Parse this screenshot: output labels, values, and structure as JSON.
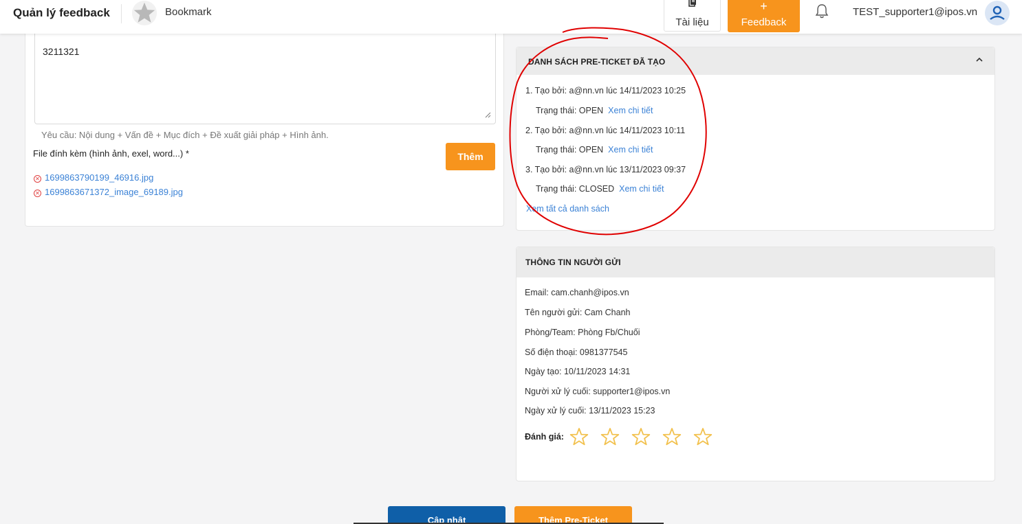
{
  "topbar": {
    "title": "Quản lý feedback",
    "bookmark_label": "Bookmark",
    "docs_label": "Tài liệu",
    "feedback_plus": "+",
    "feedback_label": "Feedback",
    "user_email": "TEST_supporter1@ipos.vn",
    "icons": [
      "star-icon",
      "book-icon",
      "bell-icon",
      "user-icon"
    ]
  },
  "form": {
    "content_value": "3211321",
    "hint": "Yêu cầu: Nội dung + Vấn đề + Mục đích + Đề xuất giải pháp + Hình ảnh.",
    "attachment_label": "File đính kèm (hình ảnh, exel, word...) *",
    "add_button": "Thêm",
    "files": [
      "1699863790199_46916.jpg",
      "1699863671372_image_69189.jpg"
    ]
  },
  "preticket": {
    "title": "DANH SÁCH PRE-TICKET ĐÃ TẠO",
    "status_prefix": "Trạng thái: ",
    "detail_link": "Xem chi tiết",
    "items": [
      {
        "created": "1. Tạo bởi: a@nn.vn lúc 14/11/2023 10:25",
        "status": "OPEN"
      },
      {
        "created": "2. Tạo bởi: a@nn.vn lúc 14/11/2023 10:11",
        "status": "OPEN"
      },
      {
        "created": "3. Tạo bởi: a@nn.vn lúc 13/11/2023 09:37",
        "status": "CLOSED"
      }
    ],
    "see_all": "Xem tất cả danh sách"
  },
  "sender": {
    "title": "THÔNG TIN NGƯỜI GỬI",
    "email": "Email: cam.chanh@ipos.vn",
    "name": "Tên người gửi: Cam Chanh",
    "team": "Phòng/Team: Phòng Fb/Chuối",
    "phone": "Số điện thoại: 0981377545",
    "created_date": "Ngày tạo: 10/11/2023 14:31",
    "last_handler": "Người xử lý cuối: supporter1@ipos.vn",
    "last_handled_date": "Ngày xử lý cuối: 13/11/2023 15:23",
    "rating_label": "Đánh giá:",
    "rating_value": 0,
    "rating_max": 5
  },
  "actions": {
    "update": "Cập nhật",
    "add_preticket": "Thêm Pre-Ticket"
  },
  "colors": {
    "accent_orange": "#f7941d",
    "primary_blue": "#0f5fa8",
    "link_blue": "#3b82d6",
    "star_yellow": "#f2c14e",
    "annotation_red": "#e00000"
  }
}
